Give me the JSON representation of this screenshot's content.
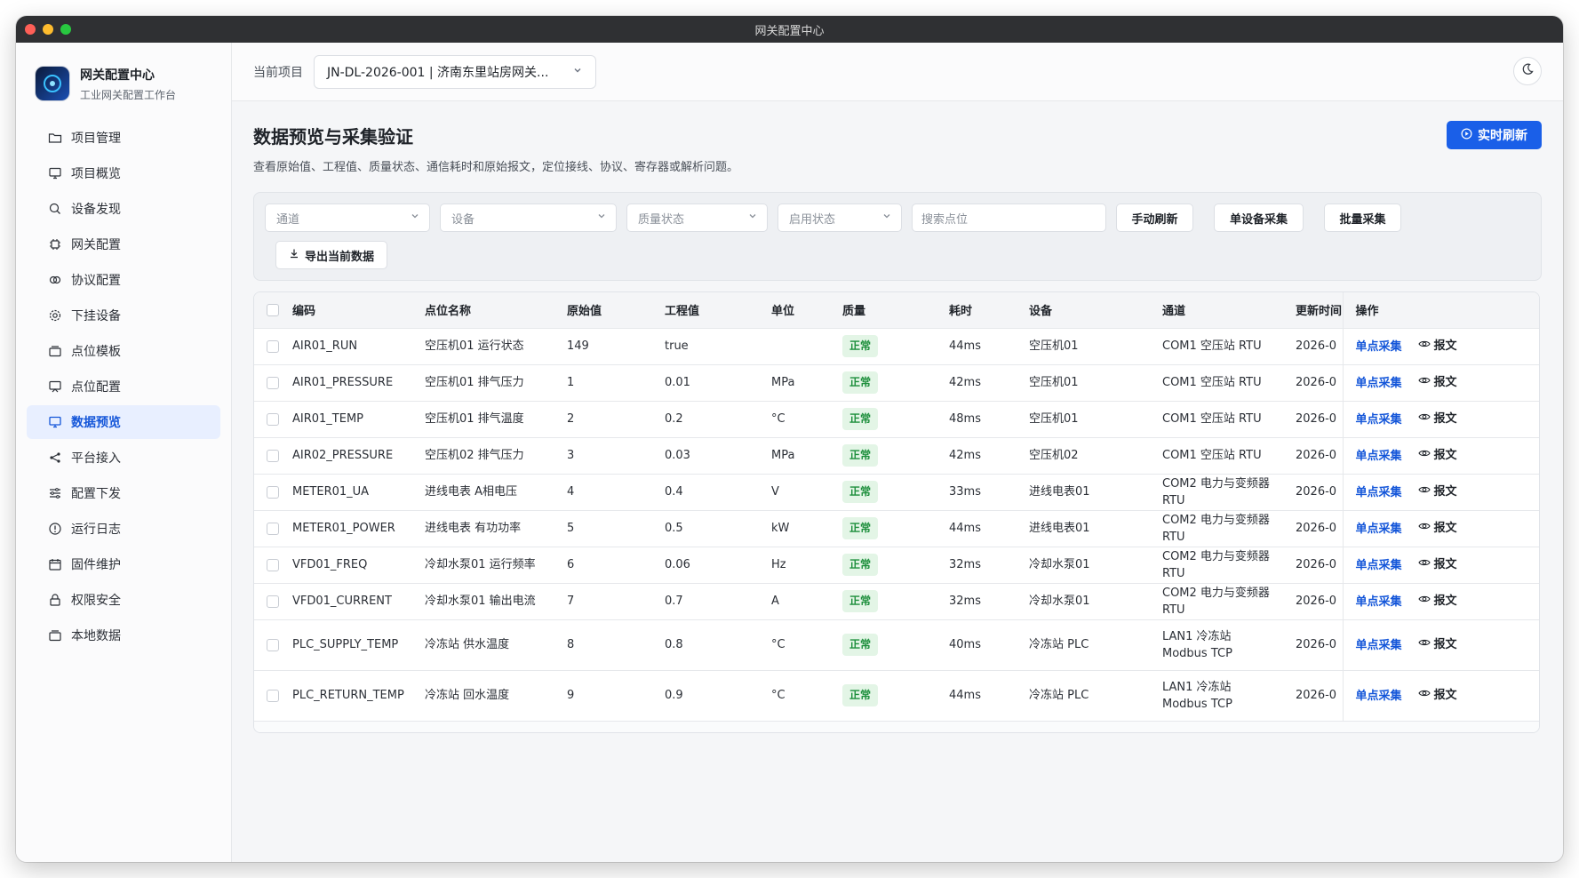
{
  "window": {
    "title": "网关配置中心"
  },
  "sidebar": {
    "brand_title": "网关配置中心",
    "brand_subtitle": "工业网关配置工作台",
    "items": [
      {
        "label": "项目管理",
        "icon": "folder-icon"
      },
      {
        "label": "项目概览",
        "icon": "monitor-icon"
      },
      {
        "label": "设备发现",
        "icon": "search-icon"
      },
      {
        "label": "网关配置",
        "icon": "chip-icon"
      },
      {
        "label": "协议配置",
        "icon": "link-icon"
      },
      {
        "label": "下挂设备",
        "icon": "gear-icon"
      },
      {
        "label": "点位模板",
        "icon": "template-icon"
      },
      {
        "label": "点位配置",
        "icon": "config-icon"
      },
      {
        "label": "数据预览",
        "icon": "display-icon",
        "active": true
      },
      {
        "label": "平台接入",
        "icon": "share-icon"
      },
      {
        "label": "配置下发",
        "icon": "sliders-icon"
      },
      {
        "label": "运行日志",
        "icon": "alert-icon"
      },
      {
        "label": "固件维护",
        "icon": "calendar-icon"
      },
      {
        "label": "权限安全",
        "icon": "lock-icon"
      },
      {
        "label": "本地数据",
        "icon": "box-icon"
      }
    ]
  },
  "topbar": {
    "project_label": "当前项目",
    "project_value": "JN-DL-2026-001 | 济南东里站房网关..."
  },
  "page": {
    "title": "数据预览与采集验证",
    "description": "查看原始值、工程值、质量状态、通信耗时和原始报文，定位接线、协议、寄存器或解析问题。",
    "live_refresh_label": "实时刷新"
  },
  "filters": {
    "channel_placeholder": "通道",
    "device_placeholder": "设备",
    "quality_placeholder": "质量状态",
    "enabled_placeholder": "启用状态",
    "search_placeholder": "搜索点位",
    "manual_refresh_label": "手动刷新",
    "single_device_label": "单设备采集",
    "batch_label": "批量采集",
    "export_label": "导出当前数据"
  },
  "table": {
    "columns": [
      "编码",
      "点位名称",
      "原始值",
      "工程值",
      "单位",
      "质量",
      "耗时",
      "设备",
      "通道",
      "更新时间",
      "操作"
    ],
    "op_collect_label": "单点采集",
    "op_message_label": "报文",
    "rows": [
      {
        "code": "AIR01_RUN",
        "name": "空压机01 运行状态",
        "raw": "149",
        "eng": "true",
        "unit": "",
        "quality": "正常",
        "latency": "44ms",
        "device": "空压机01",
        "channel": "COM1 空压站 RTU",
        "updated": "2026-0"
      },
      {
        "code": "AIR01_PRESSURE",
        "name": "空压机01 排气压力",
        "raw": "1",
        "eng": "0.01",
        "unit": "MPa",
        "quality": "正常",
        "latency": "42ms",
        "device": "空压机01",
        "channel": "COM1 空压站 RTU",
        "updated": "2026-0"
      },
      {
        "code": "AIR01_TEMP",
        "name": "空压机01 排气温度",
        "raw": "2",
        "eng": "0.2",
        "unit": "°C",
        "quality": "正常",
        "latency": "48ms",
        "device": "空压机01",
        "channel": "COM1 空压站 RTU",
        "updated": "2026-0"
      },
      {
        "code": "AIR02_PRESSURE",
        "name": "空压机02 排气压力",
        "raw": "3",
        "eng": "0.03",
        "unit": "MPa",
        "quality": "正常",
        "latency": "42ms",
        "device": "空压机02",
        "channel": "COM1 空压站 RTU",
        "updated": "2026-0"
      },
      {
        "code": "METER01_UA",
        "name": "进线电表 A相电压",
        "raw": "4",
        "eng": "0.4",
        "unit": "V",
        "quality": "正常",
        "latency": "33ms",
        "device": "进线电表01",
        "channel": "COM2 电力与变频器 RTU",
        "updated": "2026-0"
      },
      {
        "code": "METER01_POWER",
        "name": "进线电表 有功功率",
        "raw": "5",
        "eng": "0.5",
        "unit": "kW",
        "quality": "正常",
        "latency": "44ms",
        "device": "进线电表01",
        "channel": "COM2 电力与变频器 RTU",
        "updated": "2026-0"
      },
      {
        "code": "VFD01_FREQ",
        "name": "冷却水泵01 运行频率",
        "raw": "6",
        "eng": "0.06",
        "unit": "Hz",
        "quality": "正常",
        "latency": "32ms",
        "device": "冷却水泵01",
        "channel": "COM2 电力与变频器 RTU",
        "updated": "2026-0"
      },
      {
        "code": "VFD01_CURRENT",
        "name": "冷却水泵01 输出电流",
        "raw": "7",
        "eng": "0.7",
        "unit": "A",
        "quality": "正常",
        "latency": "32ms",
        "device": "冷却水泵01",
        "channel": "COM2 电力与变频器 RTU",
        "updated": "2026-0"
      },
      {
        "code": "PLC_SUPPLY_TEMP",
        "name": "冷冻站 供水温度",
        "raw": "8",
        "eng": "0.8",
        "unit": "°C",
        "quality": "正常",
        "latency": "40ms",
        "device": "冷冻站 PLC",
        "channel": "LAN1 冷冻站 Modbus TCP",
        "updated": "2026-0"
      },
      {
        "code": "PLC_RETURN_TEMP",
        "name": "冷冻站 回水温度",
        "raw": "9",
        "eng": "0.9",
        "unit": "°C",
        "quality": "正常",
        "latency": "44ms",
        "device": "冷冻站 PLC",
        "channel": "LAN1 冷冻站 Modbus TCP",
        "updated": "2026-0"
      }
    ]
  },
  "colors": {
    "accent": "#1a5fe8",
    "active_bg": "#e8efff",
    "ok_bg": "#e3f5e6",
    "ok_text": "#1d8f3c"
  }
}
